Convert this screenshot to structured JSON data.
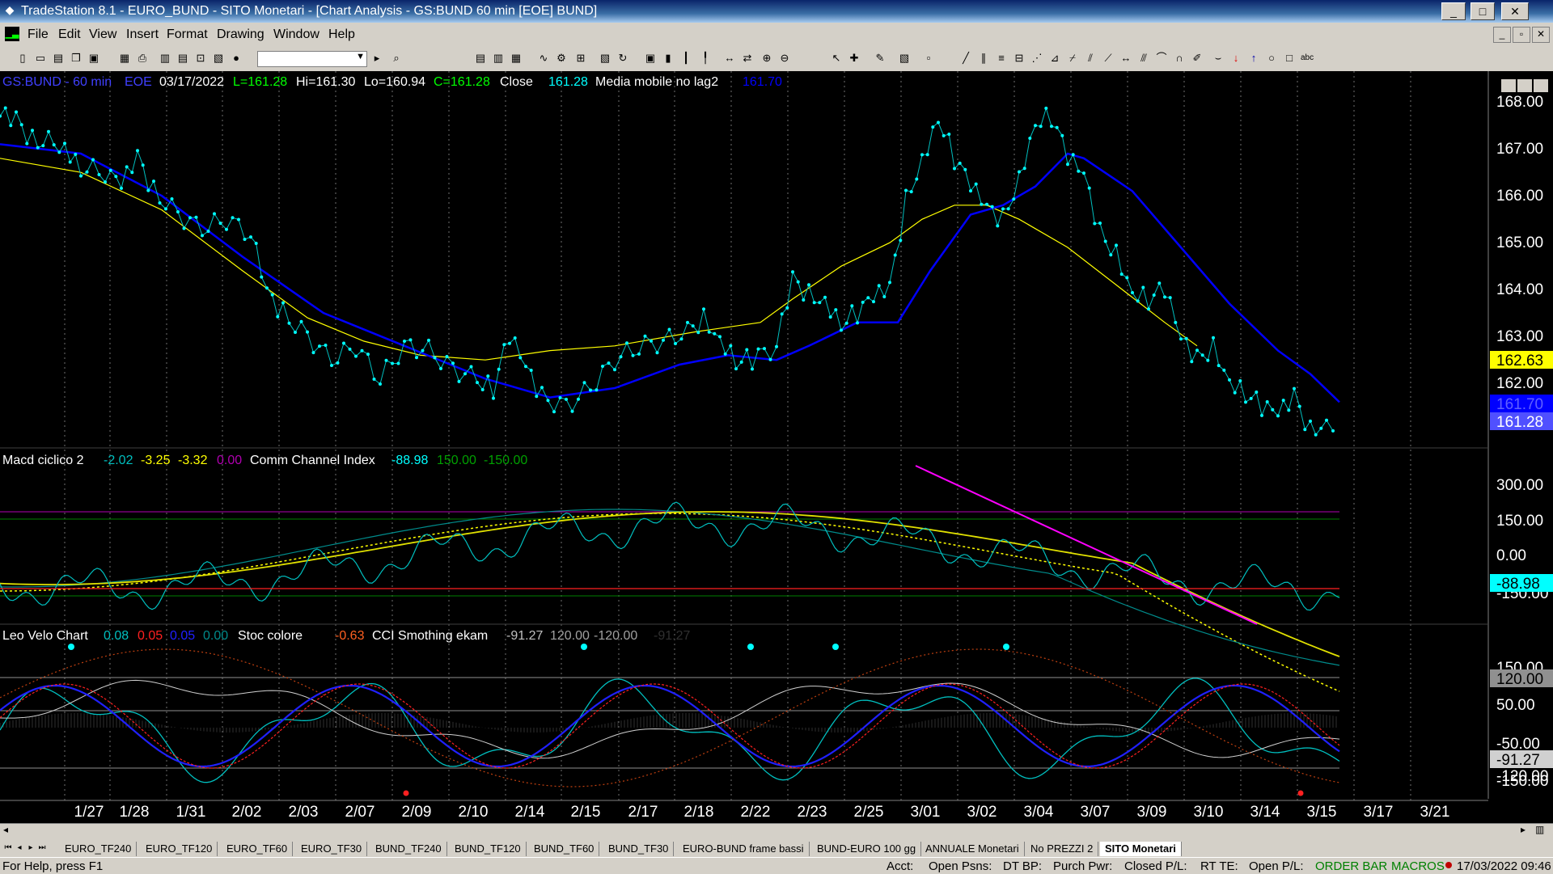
{
  "window": {
    "title": "TradeStation 8.1 - EURO_BUND - SITO Monetari - [Chart Analysis - GS:BUND  60 min  [EOE] BUND]",
    "minimize": "_",
    "maximize": "□",
    "close": "✕"
  },
  "menu": [
    "File",
    "Edit",
    "View",
    "Insert",
    "Format",
    "Drawing",
    "Window",
    "Help"
  ],
  "chart": {
    "header": {
      "symbol": "GS:BUND - 60 min",
      "session": "EOE",
      "date": "03/17/2022",
      "last": "L=161.28",
      "high": "Hi=161.30",
      "low": "Lo=160.94",
      "close": "C=161.28",
      "close_label": "Close",
      "close_value": "161.28",
      "ma_label": "Media mobile no lag2",
      "ma_value": "161.70"
    },
    "price_axis": [
      "168.00",
      "167.00",
      "166.00",
      "165.00",
      "164.00",
      "163.00",
      "162.00"
    ],
    "price_markers": {
      "yellow": "162.63",
      "blue": "161.70",
      "last": "161.28"
    },
    "panel2": {
      "name": "Macd ciclico 2",
      "v1": "-2.02",
      "v2": "-3.25",
      "v3": "-3.32",
      "v4": "0.00",
      "name2": "Comm Channel Index",
      "c1": "-88.98",
      "c2": "150.00",
      "c3": "-150.00",
      "axis": [
        "300.00",
        "150.00",
        "0.00",
        "-150.00"
      ],
      "marker": "-88.98"
    },
    "panel3": {
      "name": "Leo Velo Chart",
      "v1": "0.08",
      "v2": "0.05",
      "v3": "0.05",
      "v4": "0.00",
      "name2": "Stoc colore",
      "s1": "-0.63",
      "name3": "CCI Smothing ekam",
      "c1": "-91.27",
      "c2": "120.00",
      "c3": "-120.00",
      "c4": "-91.27",
      "axis": [
        "150.00",
        "50.00",
        "-50.00",
        "-150.00"
      ],
      "marker_gray": "120.00",
      "marker_last": "-91.27",
      "marker_neg": "-120.00"
    },
    "time_axis": [
      "1/27",
      "1/28",
      "1/31",
      "2/02",
      "2/03",
      "2/07",
      "2/09",
      "2/10",
      "2/14",
      "2/15",
      "2/17",
      "2/18",
      "2/22",
      "2/23",
      "2/25",
      "3/01",
      "3/02",
      "3/04",
      "3/07",
      "3/09",
      "3/10",
      "3/14",
      "3/15",
      "3/17",
      "3/21"
    ]
  },
  "tabs": [
    "EURO_TF240",
    "EURO_TF120",
    "EURO_TF60",
    "EURO_TF30",
    "BUND_TF240",
    "BUND_TF120",
    "BUND_TF60",
    "BUND_TF30",
    "EURO-BUND frame bassi",
    "BUND-EURO 100 gg",
    "ANNUALE Monetari",
    "No PREZZI 2",
    "SITO Monetari"
  ],
  "active_tab": "SITO Monetari",
  "status": {
    "help": "For Help, press F1",
    "acct": "Acct:",
    "open_psns": "Open Psns:",
    "dt_bp": "DT BP:",
    "purch_pwr": "Purch Pwr:",
    "closed_pl": "Closed P/L:",
    "rt_te": "RT TE:",
    "open_pl": "Open P/L:",
    "order_bar": "ORDER BAR",
    "macros": "MACROS",
    "datetime": "17/03/2022 09:46"
  },
  "colors": {
    "price_dots": "#00ffff",
    "ma_blue": "#0000ff",
    "ma_yellow": "#ffff00",
    "cci_line": "#00bfbf",
    "cci_down": "#ff0000",
    "trendline": "#ff00ff",
    "status_green": "#008000"
  }
}
